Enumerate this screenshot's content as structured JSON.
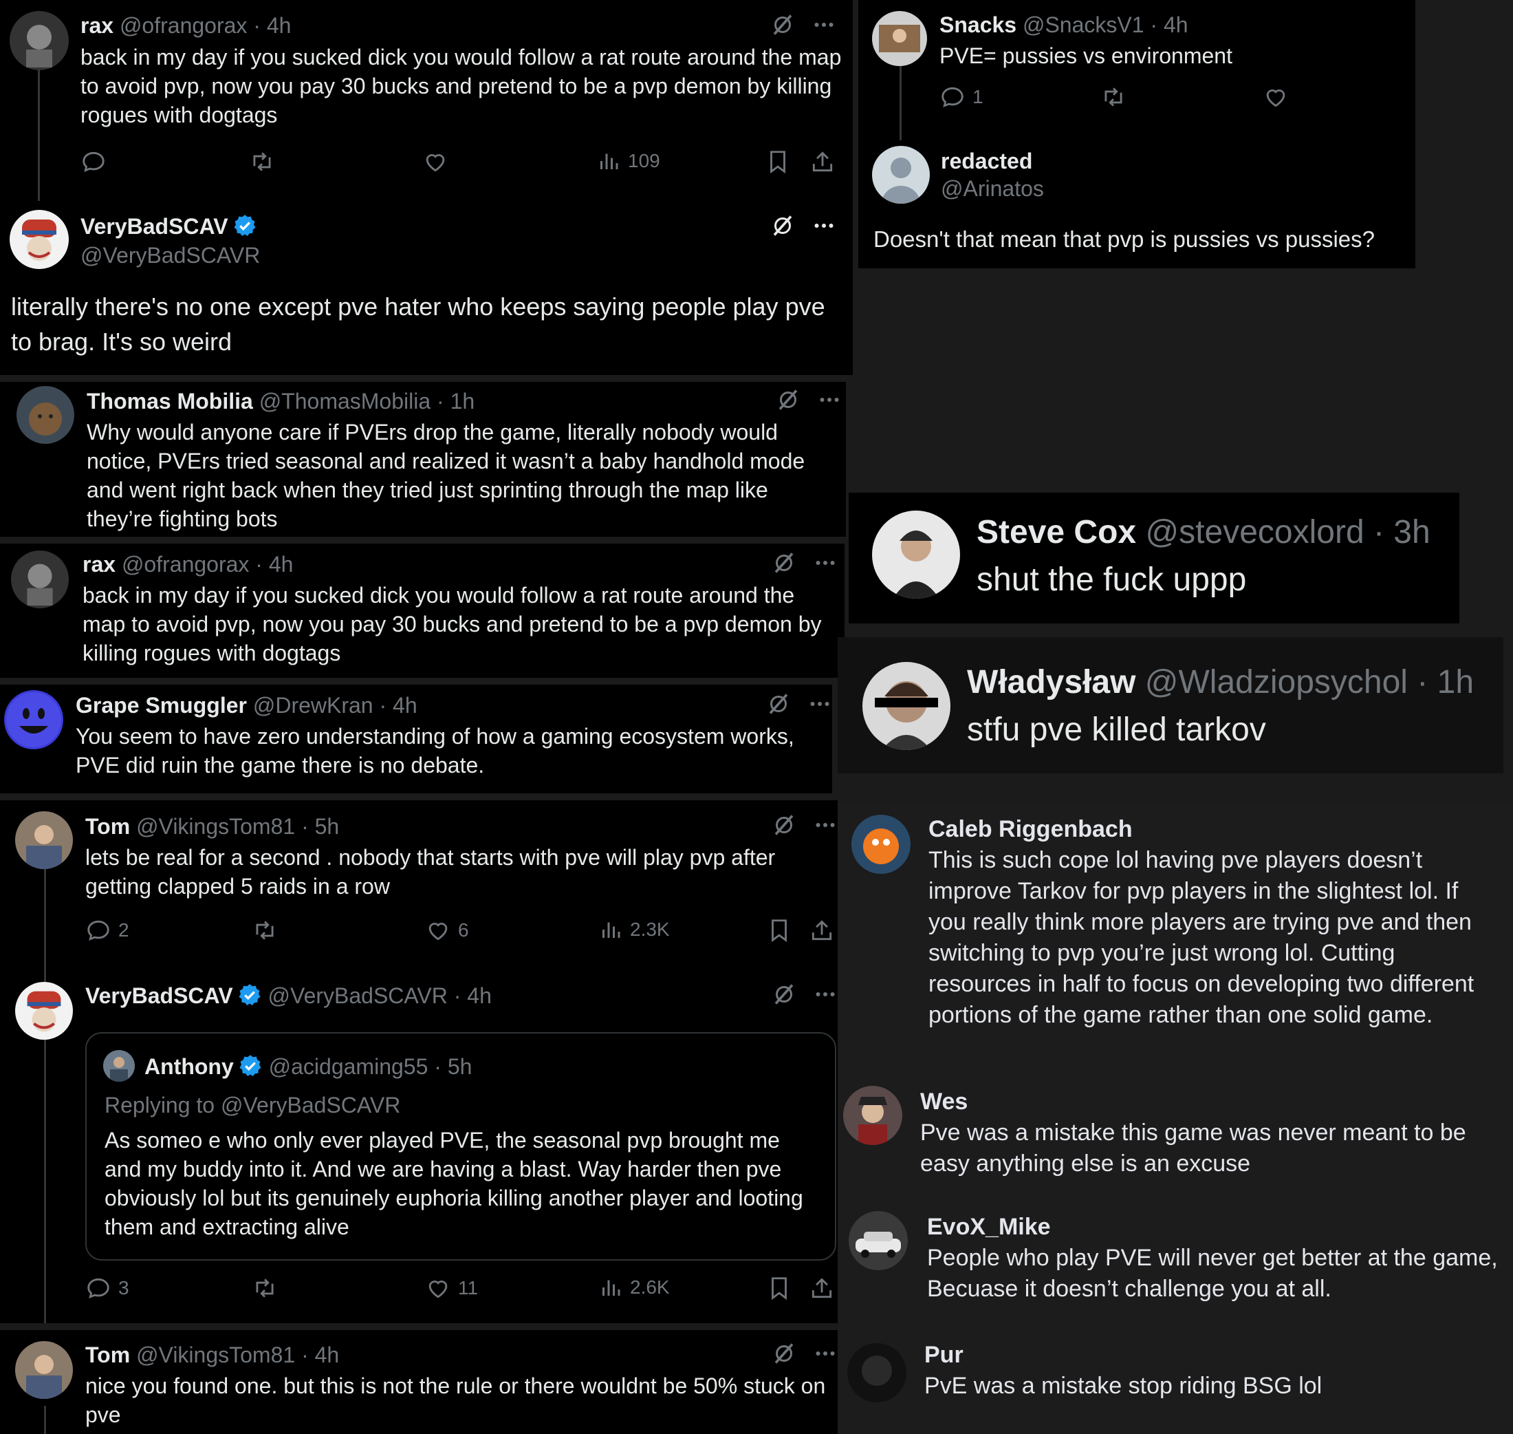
{
  "tweets": {
    "rax1": {
      "name": "rax",
      "handle": "@ofrangorax",
      "time": "· 4h",
      "text": "back in my day if you sucked dick you would follow a rat route around the map to avoid pvp, now you pay 30 bucks and pretend to be a pvp demon by killing rogues with dogtags",
      "views": "109"
    },
    "vbs1": {
      "name": "VeryBadSCAV",
      "handle": "@VeryBadSCAVR",
      "text": "literally there's no one except pve hater who keeps saying people play pve to brag. It's so weird"
    },
    "thomas": {
      "name": "Thomas Mobilia",
      "handle": "@ThomasMobilia",
      "time": "· 1h",
      "text": "Why would anyone care if PVErs drop the game, literally nobody would notice, PVErs tried seasonal and realized it wasn’t a baby handhold mode and went right back when they tried just sprinting through the map like they’re fighting bots"
    },
    "rax2": {
      "name": "rax",
      "handle": "@ofrangorax",
      "time": "· 4h",
      "text": "back in my day if you sucked dick you would follow a rat route around the map to avoid pvp, now you pay 30 bucks and pretend to be a pvp demon by killing rogues with dogtags"
    },
    "grape": {
      "name": "Grape Smuggler",
      "handle": "@DrewKran",
      "time": "· 4h",
      "text": "You seem to have zero understanding of how a gaming ecosystem works, PVE did ruin the game there is no debate."
    },
    "tom1": {
      "name": "Tom",
      "handle": "@VikingsTom81",
      "time": "· 5h",
      "text": "lets be real for a second . nobody that starts with pve will play pvp after getting clapped 5 raids in a row",
      "replies": "2",
      "likes": "6",
      "views": "2.3K"
    },
    "vbs2": {
      "name": "VeryBadSCAV",
      "handle": "@VeryBadSCAVR",
      "time": "· 4h",
      "replies": "3",
      "likes": "11",
      "views": "2.6K",
      "quote": {
        "name": "Anthony",
        "handle": "@acidgaming55",
        "time": "· 5h",
        "replying": "Replying to @VeryBadSCAVR",
        "text": "As someo e who only ever played PVE, the seasonal pvp brought me and my buddy into it. And we are having a blast. Way harder then pve obviously lol but its genuinely euphoria killing another player and looting them and extracting alive"
      }
    },
    "tom2": {
      "name": "Tom",
      "handle": "@VikingsTom81",
      "time": "· 4h",
      "text": "nice you found one. but this is not the rule or there wouldnt be 50% stuck on pve"
    },
    "snacks": {
      "name": "Snacks",
      "handle": "@SnacksV1",
      "time": "· 4h",
      "text": "PVE= pussies vs environment",
      "replies": "1"
    },
    "redacted": {
      "name": "redacted",
      "handle": "@Arinatos",
      "text": "Doesn't that mean that pvp is pussies vs pussies?"
    },
    "steve": {
      "name": "Steve Cox",
      "handle": "@stevecoxlord",
      "time": "· 3h",
      "text": "shut the fuck uppp"
    },
    "wlad": {
      "name": "Władysław",
      "handle": "@Wladziopsychol",
      "time": "· 1h",
      "text": "stfu pve killed tarkov"
    }
  },
  "comments": {
    "caleb": {
      "name": "Caleb Riggenbach",
      "text": "This is such cope lol having pve players doesn’t improve Tarkov for pvp players in the slightest lol. If you really think more players are trying pve and then switching to pvp you’re just wrong lol. Cutting resources in half to focus on developing two different portions of the game rather than one solid game."
    },
    "wes": {
      "name": "Wes",
      "text": "Pve was a mistake this game was never meant to be easy anything else is an excuse"
    },
    "evox": {
      "name": "EvoX_Mike",
      "text": "People who play PVE will never get better at the game, Becuase it doesn’t challenge you at all."
    },
    "pur": {
      "name": "Pur",
      "text": "PvE was a mistake stop riding BSG lol"
    }
  },
  "colors": {
    "accent": "#1d9bf0",
    "muted": "#71767b",
    "background": "#000000",
    "comment_bg": "#1c1c1c"
  }
}
